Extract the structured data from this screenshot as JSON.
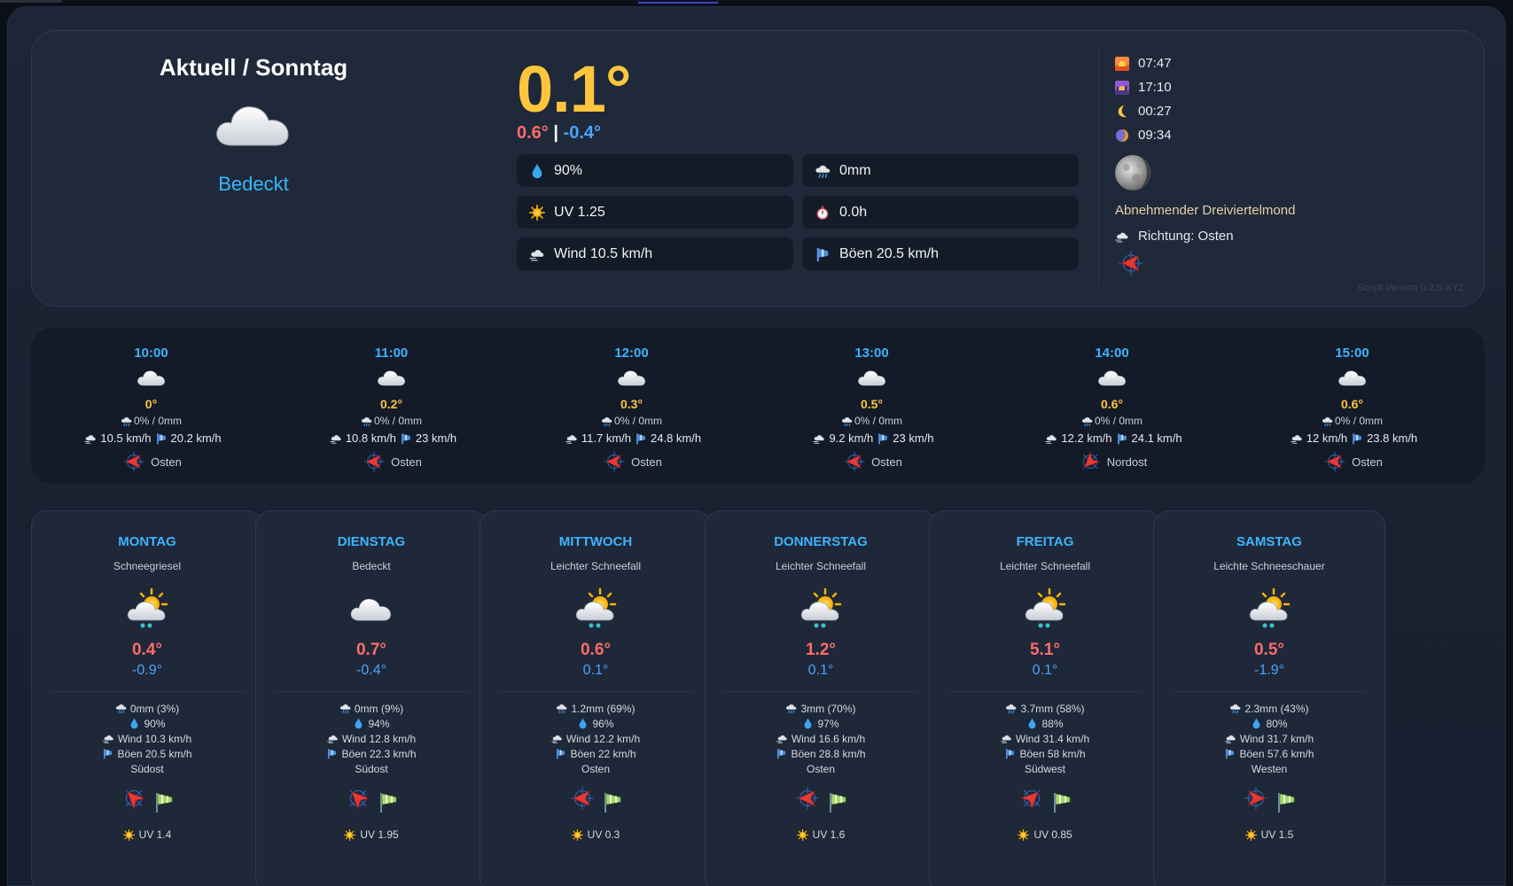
{
  "current": {
    "title": "Aktuell / Sonntag",
    "icon": "cloud-icon",
    "description": "Bedeckt",
    "temperature": "0.1°",
    "max": "0.6°",
    "separator": "|",
    "min": "-0.4°",
    "stats": {
      "humidity": "90%",
      "precipitation": "0mm",
      "uv": "UV 1.25",
      "sunshine": "0.0h",
      "wind": "Wind 10.5 km/h",
      "gusts": "Böen 20.5 km/h"
    },
    "astro": {
      "sunrise": "07:47",
      "sunset": "17:10",
      "moonrise": "00:27",
      "moonset": "09:34"
    },
    "moon_phase": "Abnehmender Dreiviertelmond",
    "direction": "Richtung: Osten",
    "version": "Script Version 0.2.6-XYZ"
  },
  "hourly": [
    {
      "time": "10:00",
      "temp": "0°",
      "precip": "0% / 0mm",
      "wind": "10.5 km/h",
      "gust": "20.2 km/h",
      "dir": "Osten",
      "deg": 90
    },
    {
      "time": "11:00",
      "temp": "0.2°",
      "precip": "0% / 0mm",
      "wind": "10.8 km/h",
      "gust": "23 km/h",
      "dir": "Osten",
      "deg": 90
    },
    {
      "time": "12:00",
      "temp": "0.3°",
      "precip": "0% / 0mm",
      "wind": "11.7 km/h",
      "gust": "24.8 km/h",
      "dir": "Osten",
      "deg": 90
    },
    {
      "time": "13:00",
      "temp": "0.5°",
      "precip": "0% / 0mm",
      "wind": "9.2 km/h",
      "gust": "23 km/h",
      "dir": "Osten",
      "deg": 90
    },
    {
      "time": "14:00",
      "temp": "0.6°",
      "precip": "0% / 0mm",
      "wind": "12.2 km/h",
      "gust": "24.1 km/h",
      "dir": "Nordost",
      "deg": 45
    },
    {
      "time": "15:00",
      "temp": "0.6°",
      "precip": "0% / 0mm",
      "wind": "12 km/h",
      "gust": "23.8 km/h",
      "dir": "Osten",
      "deg": 90
    }
  ],
  "daily": [
    {
      "name": "MONTAG",
      "desc": "Schneegriesel",
      "icon": "sun-cloud-snow-icon",
      "max": "0.4°",
      "min": "-0.9°",
      "precip": "0mm (3%)",
      "humidity": "90%",
      "wind": "Wind 10.3 km/h",
      "gust": "Böen 20.5 km/h",
      "dir": "Südost",
      "deg": 135,
      "uv": "UV 1.4"
    },
    {
      "name": "DIENSTAG",
      "desc": "Bedeckt",
      "icon": "cloud-icon",
      "max": "0.7°",
      "min": "-0.4°",
      "precip": "0mm (9%)",
      "humidity": "94%",
      "wind": "Wind 12.8 km/h",
      "gust": "Böen 22.3 km/h",
      "dir": "Südost",
      "deg": 135,
      "uv": "UV 1.95"
    },
    {
      "name": "MITTWOCH",
      "desc": "Leichter Schneefall",
      "icon": "sun-cloud-snow-icon",
      "max": "0.6°",
      "min": "0.1°",
      "precip": "1.2mm (69%)",
      "humidity": "96%",
      "wind": "Wind 12.2 km/h",
      "gust": "Böen 22 km/h",
      "dir": "Osten",
      "deg": 90,
      "uv": "UV 0.3"
    },
    {
      "name": "DONNERSTAG",
      "desc": "Leichter Schneefall",
      "icon": "sun-cloud-snow-icon",
      "max": "1.2°",
      "min": "0.1°",
      "precip": "3mm (70%)",
      "humidity": "97%",
      "wind": "Wind 16.6 km/h",
      "gust": "Böen 28.8 km/h",
      "dir": "Osten",
      "deg": 90,
      "uv": "UV 1.6"
    },
    {
      "name": "FREITAG",
      "desc": "Leichter Schneefall",
      "icon": "sun-cloud-snow-icon",
      "max": "5.1°",
      "min": "0.1°",
      "precip": "3.7mm (58%)",
      "humidity": "88%",
      "wind": "Wind 31.4 km/h",
      "gust": "Böen 58 km/h",
      "dir": "Südwest",
      "deg": 225,
      "uv": "UV 0.85"
    },
    {
      "name": "SAMSTAG",
      "desc": "Leichte Schneeschauer",
      "icon": "sun-cloud-snow-icon",
      "max": "0.5°",
      "min": "-1.9°",
      "precip": "2.3mm (43%)",
      "humidity": "80%",
      "wind": "Wind 31.7 km/h",
      "gust": "Böen 57.6 km/h",
      "dir": "Westen",
      "deg": 270,
      "uv": "UV 1.5"
    }
  ],
  "colors": {
    "accent_blue": "#3fb3ff",
    "temp_yellow": "#ffc53d",
    "max_red": "#ff6b6b",
    "min_blue": "#4da3ff"
  }
}
